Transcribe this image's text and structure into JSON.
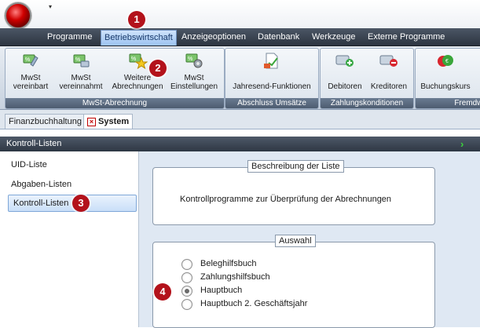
{
  "menu": {
    "tabs": [
      "Programme",
      "Betriebswirtschaft",
      "Anzeigeoptionen",
      "Datenbank",
      "Werkzeuge",
      "Externe Programme"
    ],
    "active_index": 1
  },
  "ribbon": {
    "groups": [
      {
        "label": "MwSt-Abrechnung",
        "buttons": [
          {
            "line1": "MwSt",
            "line2": "vereinbart"
          },
          {
            "line1": "MwSt",
            "line2": "vereinnahmt"
          },
          {
            "line1": "Weitere",
            "line2": "Abrechnungen"
          },
          {
            "line1": "MwSt",
            "line2": "Einstellungen"
          }
        ]
      },
      {
        "label": "Abschluss Umsätze",
        "buttons": [
          {
            "line1": "",
            "line2": "Jahresend-Funktionen"
          }
        ]
      },
      {
        "label": "Zahlungskonditionen",
        "buttons": [
          {
            "line1": "",
            "line2": "Debitoren"
          },
          {
            "line1": "",
            "line2": "Kreditoren"
          }
        ]
      },
      {
        "label": "Fremdwä",
        "buttons": [
          {
            "line1": "",
            "line2": "Buchungskurs"
          }
        ]
      }
    ]
  },
  "doc_tabs": [
    {
      "label": "Finanzbuchhaltung",
      "active": false
    },
    {
      "label": "System",
      "active": true
    }
  ],
  "panel": {
    "title": "Kontroll-Listen"
  },
  "left_list": {
    "items": [
      "UID-Liste",
      "Abgaben-Listen",
      "Kontroll-Listen"
    ],
    "selected_index": 2
  },
  "description_box": {
    "legend": "Beschreibung der Liste",
    "text": "Kontrollprogramme zur Überprüfung der Abrechnungen"
  },
  "selection_box": {
    "legend": "Auswahl",
    "options": [
      "Beleghilfsbuch",
      "Zahlungshilfsbuch",
      "Hauptbuch",
      "Hauptbuch 2. Geschäftsjahr"
    ],
    "selected_index": 2
  },
  "markers": [
    "1",
    "2",
    "3",
    "4"
  ],
  "colors": {
    "menubar": "#2d3541",
    "active_tab": "#9cc3f1",
    "marker": "#b3121b",
    "panel_header": "#2e3744",
    "content_bg": "#dfe8f3"
  },
  "icons": [
    "app-orb-icon",
    "quick-access-arrow-icon",
    "mwst-vereinbart-icon",
    "mwst-vereinnahmt-icon",
    "weitere-abrechnungen-star-icon",
    "mwst-einstellungen-gear-icon",
    "jahresend-document-icon",
    "debitoren-plus-icon",
    "kreditoren-minus-icon",
    "buchungskurs-currency-icon",
    "close-tab-icon",
    "panel-arrow-icon"
  ]
}
